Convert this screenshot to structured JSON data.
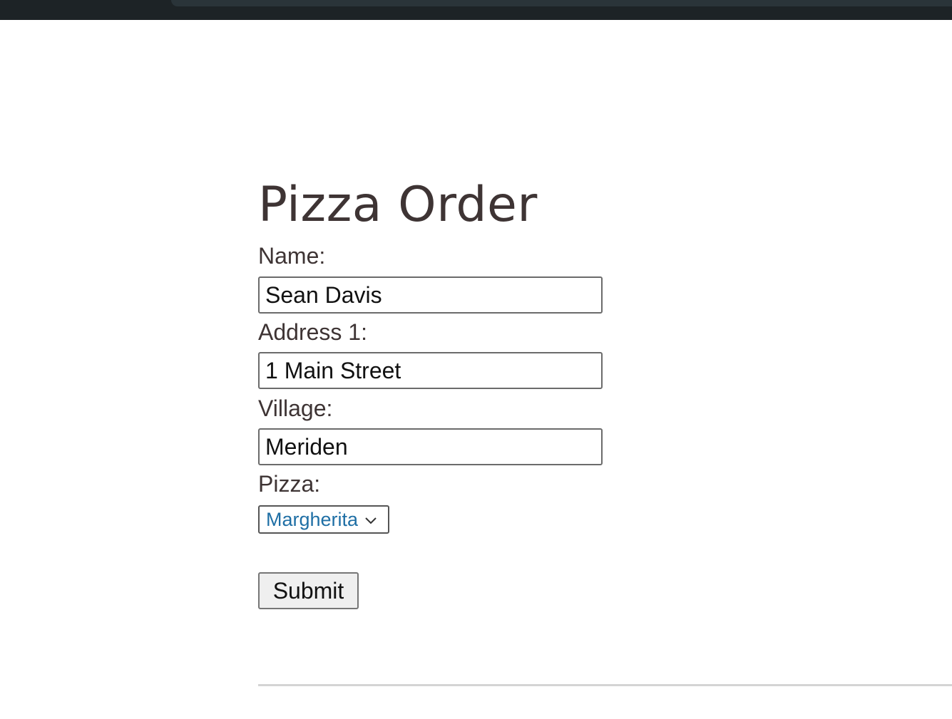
{
  "form": {
    "title": "Pizza Order",
    "name": {
      "label": "Name:",
      "value": "Sean Davis"
    },
    "address1": {
      "label": "Address 1:",
      "value": "1 Main Street"
    },
    "village": {
      "label": "Village:",
      "value": "Meriden"
    },
    "pizza": {
      "label": "Pizza:",
      "selected": "Margherita"
    },
    "submit_label": "Submit"
  },
  "colors": {
    "top_bar": "#1d2326",
    "text": "#3e3434",
    "select_text": "#1f6fa5",
    "button_bg": "#efefef"
  },
  "icons": {
    "pizza_select": "chevron-down-icon"
  }
}
